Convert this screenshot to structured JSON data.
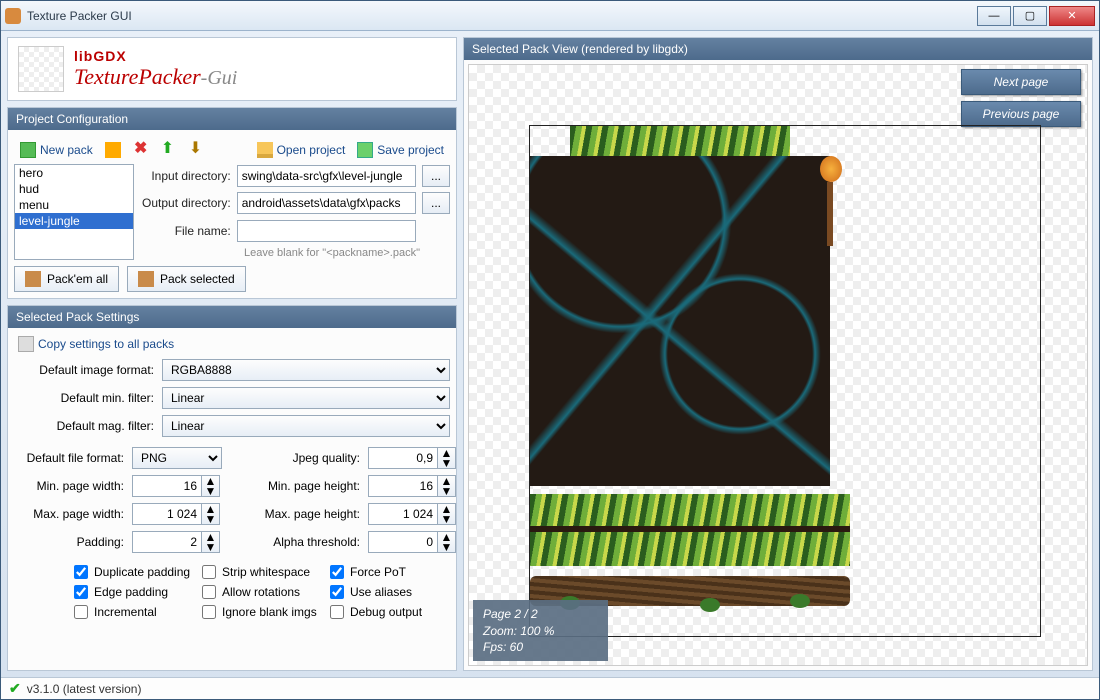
{
  "window": {
    "title": "Texture Packer GUI"
  },
  "logo": {
    "lib": "libGDX",
    "tp": "TexturePacker",
    "gui": "-Gui"
  },
  "project": {
    "header": "Project Configuration",
    "new_pack": "New pack",
    "open_project": "Open project",
    "save_project": "Save project",
    "packs": [
      "hero",
      "hud",
      "menu",
      "level-jungle"
    ],
    "selected_pack_index": 3,
    "input_label": "Input directory:",
    "input_value": "swing\\data-src\\gfx\\level-jungle",
    "output_label": "Output directory:",
    "output_value": "android\\assets\\data\\gfx\\packs",
    "filename_label": "File name:",
    "filename_value": "",
    "filename_hint": "Leave blank for \"<packname>.pack\"",
    "pack_all": "Pack'em all",
    "pack_selected": "Pack selected"
  },
  "settings": {
    "header": "Selected Pack Settings",
    "copy_all": "Copy settings to all packs",
    "img_format_label": "Default image format:",
    "img_format": "RGBA8888",
    "min_filter_label": "Default min. filter:",
    "min_filter": "Linear",
    "mag_filter_label": "Default mag. filter:",
    "mag_filter": "Linear",
    "file_format_label": "Default file format:",
    "file_format": "PNG",
    "jpeg_q_label": "Jpeg quality:",
    "jpeg_q": "0,9",
    "min_w_label": "Min. page width:",
    "min_w": "16",
    "min_h_label": "Min. page height:",
    "min_h": "16",
    "max_w_label": "Max. page width:",
    "max_w": "1 024",
    "max_h_label": "Max. page height:",
    "max_h": "1 024",
    "padding_label": "Padding:",
    "padding": "2",
    "alpha_label": "Alpha threshold:",
    "alpha": "0",
    "checks": {
      "dup_padding": {
        "label": "Duplicate padding",
        "checked": true
      },
      "strip_ws": {
        "label": "Strip whitespace",
        "checked": false
      },
      "force_pot": {
        "label": "Force PoT",
        "checked": true
      },
      "edge_padding": {
        "label": "Edge padding",
        "checked": true
      },
      "allow_rot": {
        "label": "Allow rotations",
        "checked": false
      },
      "use_aliases": {
        "label": "Use aliases",
        "checked": true
      },
      "incremental": {
        "label": "Incremental",
        "checked": false
      },
      "ignore_blank": {
        "label": "Ignore blank imgs",
        "checked": false
      },
      "debug_output": {
        "label": "Debug output",
        "checked": false
      }
    }
  },
  "preview": {
    "header": "Selected Pack View (rendered by libgdx)",
    "next": "Next page",
    "prev": "Previous page",
    "status_page": "Page 2 / 2",
    "status_zoom": "Zoom: 100 %",
    "status_fps": "Fps: 60"
  },
  "footer": {
    "version": "v3.1.0 (latest version)"
  }
}
